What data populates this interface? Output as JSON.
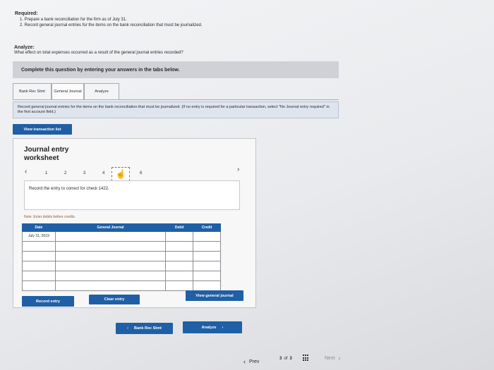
{
  "required": {
    "title": "Required:",
    "items": [
      "1. Prepare a bank reconciliation for the firm as of July 31.",
      "2. Record general journal entries for the items on the bank reconciliation that must be journalized."
    ]
  },
  "analyze": {
    "title": "Analyze:",
    "question": "What effect on total expenses occurred as a result of the general journal entries recorded?"
  },
  "banner": "Complete this question by entering your answers in the tabs below.",
  "tabs": [
    {
      "label": "Bank Rec Stmt"
    },
    {
      "label": "General Journal"
    },
    {
      "label": "Analyze"
    }
  ],
  "instruction": "Record general journal entries for the items on the bank reconciliation that must be journalized. (If no entry is required for a particular transaction, select \"No Journal entry required\" in the first account field.)",
  "view_transaction_list": "View transaction list",
  "worksheet": {
    "title": "Journal entry worksheet",
    "pages": [
      "1",
      "2",
      "3",
      "4",
      "5",
      "6"
    ],
    "entry_prompt": "Record the entry to correct for check 1422.",
    "note": "Note: Enter debits before credits.",
    "columns": [
      "Date",
      "General Journal",
      "Debit",
      "Credit"
    ],
    "date_value": "July 31, 2019"
  },
  "buttons": {
    "record_entry": "Record entry",
    "clear_entry": "Clear entry",
    "view_general_journal": "View general journal"
  },
  "tab_nav": {
    "prev": "Bank Rec Stmt",
    "next": "Analyze"
  },
  "pager": {
    "prev": "Prev",
    "current": "3",
    "of_label": "of",
    "total": "3",
    "next": "Next"
  },
  "colors": {
    "accent": "#1f5fa6"
  }
}
